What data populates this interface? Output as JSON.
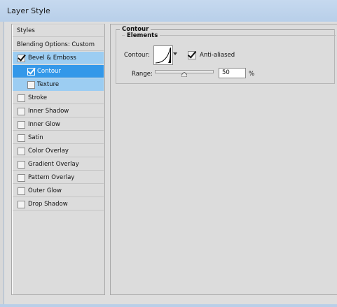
{
  "window": {
    "title": "Layer Style"
  },
  "styles_list": {
    "header": "Styles",
    "blending": "Blending Options: Custom",
    "items": [
      {
        "label": "Bevel & Emboss",
        "checked": true
      },
      {
        "label": "Contour",
        "checked": true
      },
      {
        "label": "Texture",
        "checked": false
      },
      {
        "label": "Stroke",
        "checked": false
      },
      {
        "label": "Inner Shadow",
        "checked": false
      },
      {
        "label": "Inner Glow",
        "checked": false
      },
      {
        "label": "Satin",
        "checked": false
      },
      {
        "label": "Color Overlay",
        "checked": false
      },
      {
        "label": "Gradient Overlay",
        "checked": false
      },
      {
        "label": "Pattern Overlay",
        "checked": false
      },
      {
        "label": "Outer Glow",
        "checked": false
      },
      {
        "label": "Drop Shadow",
        "checked": false
      }
    ]
  },
  "contour_panel": {
    "section_title": "Contour",
    "group_title": "Elements",
    "contour_label": "Contour:",
    "anti_aliased_label": "Anti-aliased",
    "anti_aliased": true,
    "range_label": "Range:",
    "range_value": "50",
    "range_unit": "%",
    "range_fraction": 0.5
  },
  "colors": {
    "selected_row": "#3398e9",
    "parent_row": "#9ccdf2",
    "titlebar": "#c6d9ef"
  }
}
